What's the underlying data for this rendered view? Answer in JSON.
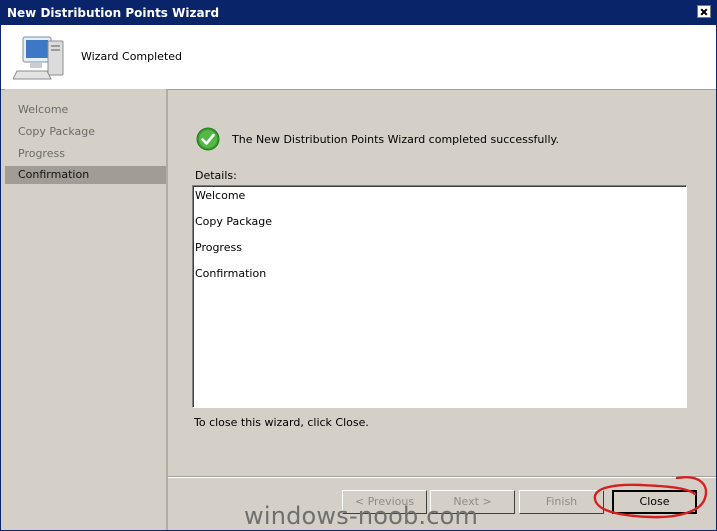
{
  "window": {
    "title": "New Distribution Points Wizard",
    "close_icon": "close-icon"
  },
  "header": {
    "icon": "computer-icon",
    "title": "Wizard Completed"
  },
  "sidebar": {
    "items": [
      {
        "label": "Welcome",
        "active": false
      },
      {
        "label": "Copy Package",
        "active": false
      },
      {
        "label": "Progress",
        "active": false
      },
      {
        "label": "Confirmation",
        "active": true
      }
    ]
  },
  "main": {
    "status_icon": "success-check-icon",
    "success_message": "The New Distribution Points Wizard completed successfully.",
    "details_label": "Details:",
    "details_lines": [
      "Welcome",
      "Copy Package",
      "Progress",
      "Confirmation"
    ],
    "close_hint": "To close this wizard, click Close."
  },
  "footer": {
    "previous_label": "< Previous",
    "next_label": "Next >",
    "finish_label": "Finish",
    "close_label": "Close"
  },
  "overlay": {
    "watermark_text": "windows-noob.com",
    "annotation": "red-circle-highlight"
  },
  "colors": {
    "titlebar": "#0a246a",
    "dialog_bg": "#d4d0c8",
    "sidebar_active": "#a19d96",
    "check_green": "#3a9a2e",
    "annotation_red": "#d62020"
  }
}
